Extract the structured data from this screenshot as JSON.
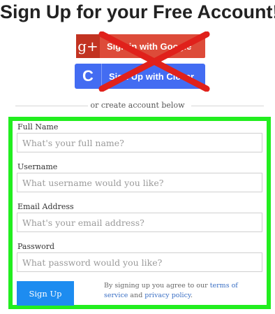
{
  "page": {
    "title": "Sign Up for your Free Account!"
  },
  "social": {
    "google_icon": "g+",
    "google_label": "Sign in with Google",
    "clever_icon": "C",
    "clever_label": "Sign Up with Clever",
    "cross_color": "#e0211b"
  },
  "divider": {
    "text": "or create account below"
  },
  "form": {
    "highlight_color": "#22ee1f",
    "fields": [
      {
        "label": "Full Name",
        "placeholder": "What's your full name?"
      },
      {
        "label": "Username",
        "placeholder": "What username would you like?"
      },
      {
        "label": "Email Address",
        "placeholder": "What's your email address?"
      },
      {
        "label": "Password",
        "placeholder": "What password would you like?"
      }
    ],
    "submit_label": "Sign Up",
    "terms_prefix": "By signing up you agree to our ",
    "terms_link": "terms of service",
    "terms_and": " and ",
    "privacy_link": "privacy policy",
    "terms_suffix": "."
  }
}
